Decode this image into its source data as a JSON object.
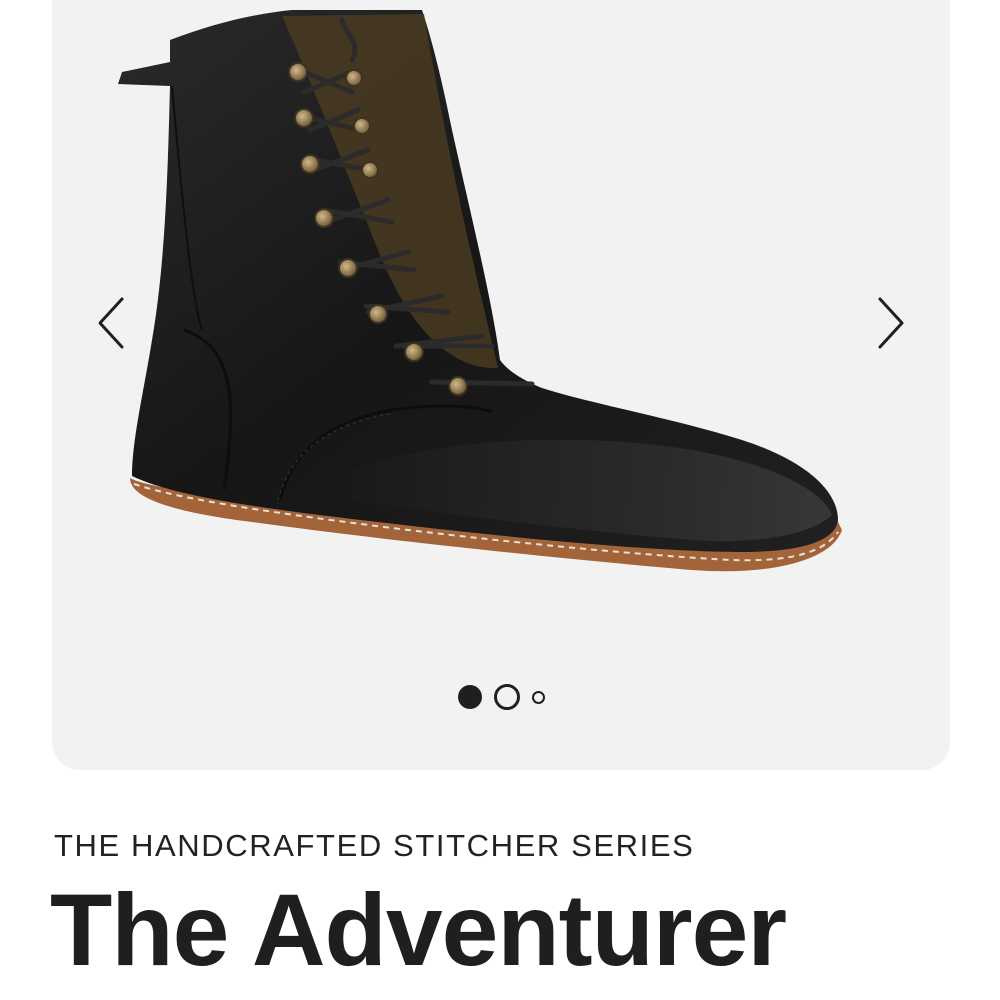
{
  "gallery": {
    "image_alt": "Black leather lace-up boot with brown stitched sole",
    "prev_icon": "chevron-left-icon",
    "next_icon": "chevron-right-icon",
    "slide_count": 3,
    "active_slide": 1
  },
  "product": {
    "series": "THE HANDCRAFTED STITCHER SERIES",
    "name": "The Adventurer"
  },
  "colors": {
    "gallery_bg": "#f2f2f2",
    "text": "#222222",
    "leather": "#1c1c1c",
    "sole": "#a3643a",
    "eyelet": "#9a8256"
  }
}
